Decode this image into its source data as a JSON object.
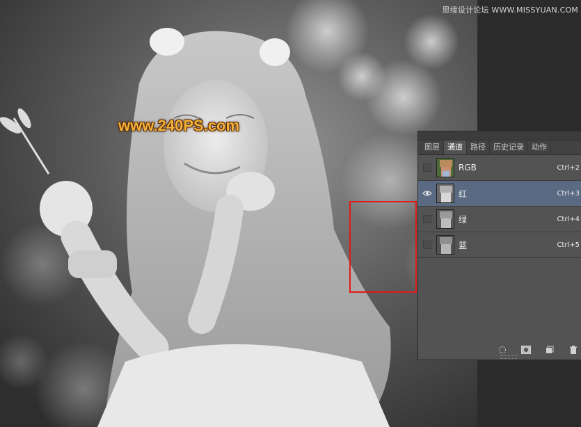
{
  "watermark": {
    "site_top": "思缘设计论坛 WWW.MISSYUAN.COM",
    "site_main": "www.240PS.com"
  },
  "channels_panel": {
    "tabs": [
      {
        "label": "图层",
        "active": false
      },
      {
        "label": "通道",
        "active": true
      },
      {
        "label": "路径",
        "active": false
      },
      {
        "label": "历史记录",
        "active": false
      },
      {
        "label": "动作",
        "active": false
      }
    ],
    "channels": [
      {
        "name": "RGB",
        "shortcut": "Ctrl+2",
        "visible": false,
        "selected": false,
        "thumb": "color"
      },
      {
        "name": "红",
        "shortcut": "Ctrl+3",
        "visible": true,
        "selected": true,
        "thumb": "gray"
      },
      {
        "name": "绿",
        "shortcut": "Ctrl+4",
        "visible": false,
        "selected": false,
        "thumb": "gray"
      },
      {
        "name": "蓝",
        "shortcut": "Ctrl+5",
        "visible": false,
        "selected": false,
        "thumb": "gray"
      }
    ],
    "footer_icons": [
      "load-selection-icon",
      "save-selection-icon",
      "new-channel-icon",
      "delete-channel-icon"
    ]
  },
  "colors": {
    "panel_bg": "#535353",
    "selected_row": "#596a82",
    "highlight_box": "#e01a1a",
    "watermark_orange": "#f3b23c"
  }
}
